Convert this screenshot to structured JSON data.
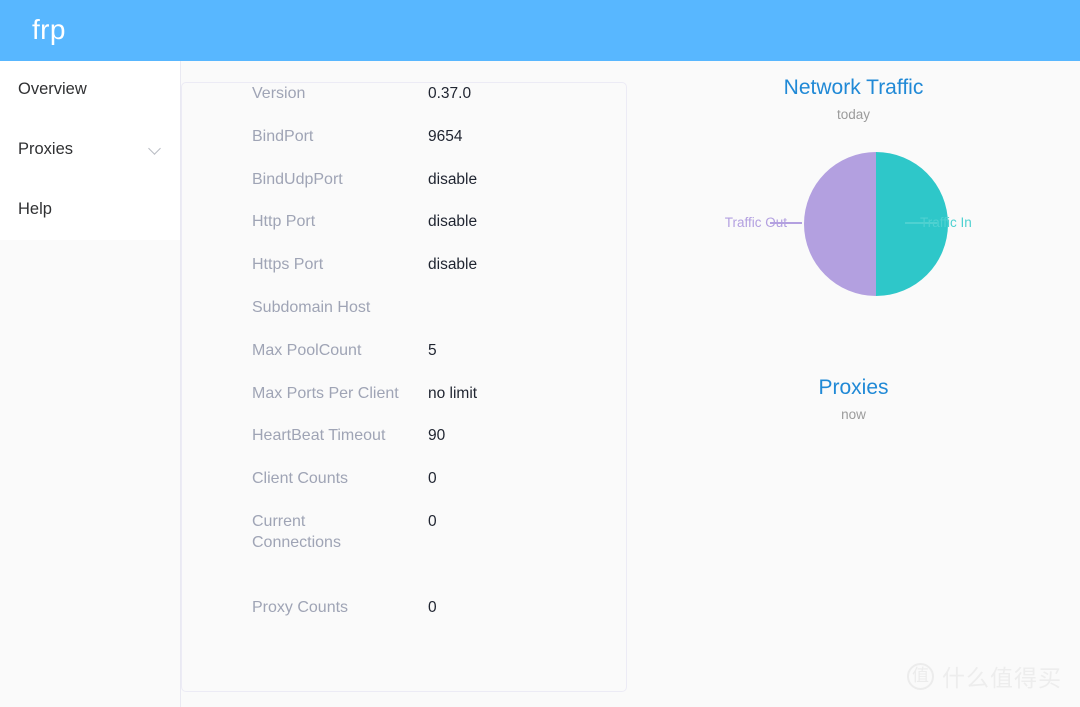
{
  "header": {
    "title": "frp",
    "bg_color": "#58b7ff"
  },
  "sidebar": {
    "items": [
      {
        "label": "Overview",
        "icon": "",
        "has_chevron": false
      },
      {
        "label": "Proxies",
        "icon": "chevron-down-icon",
        "has_chevron": true
      },
      {
        "label": "Help",
        "icon": "",
        "has_chevron": false
      }
    ]
  },
  "info_card": {
    "rows": [
      {
        "key": "Version",
        "value": "0.37.0"
      },
      {
        "key": "BindPort",
        "value": "9654"
      },
      {
        "key": "BindUdpPort",
        "value": "disable"
      },
      {
        "key": "Http Port",
        "value": "disable"
      },
      {
        "key": "Https Port",
        "value": "disable"
      },
      {
        "key": "Subdomain Host",
        "value": ""
      },
      {
        "key": "Max PoolCount",
        "value": "5"
      },
      {
        "key": "Max Ports Per Client",
        "value": "no limit"
      },
      {
        "key": "HeartBeat Timeout",
        "value": "90"
      },
      {
        "key": "Client Counts",
        "value": "0"
      },
      {
        "key": "Current Connections",
        "value": "0"
      },
      {
        "key": "Proxy Counts",
        "value": "0"
      }
    ]
  },
  "chart_data": [
    {
      "type": "pie",
      "title": "Network Traffic",
      "subtitle": "today",
      "title_color": "#2089d6",
      "categories": [
        "Traffic In",
        "Traffic Out"
      ],
      "values": [
        50,
        50
      ],
      "colors": [
        "#2ec7c9",
        "#b3a0e0"
      ],
      "legend_position": "outside-labels",
      "labels": [
        {
          "name": "Traffic Out",
          "side": "left",
          "color": "#b3a0e0",
          "value": 50
        },
        {
          "name": "Traffic In",
          "side": "right",
          "color": "#4ed1d1",
          "value": 50
        }
      ]
    },
    {
      "type": "pie",
      "title": "Proxies",
      "subtitle": "now",
      "title_color": "#2089d6",
      "categories": [],
      "values": [],
      "colors": [],
      "labels": []
    }
  ],
  "watermark": {
    "badge": "值",
    "text": "什么值得买"
  }
}
